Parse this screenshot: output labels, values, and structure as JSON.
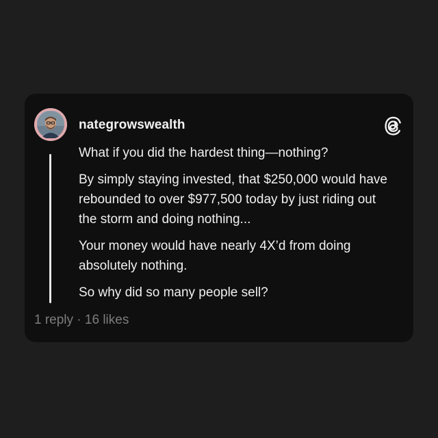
{
  "post": {
    "username": "nategrowswealth",
    "avatar_icon": "user-avatar-photo",
    "logo_icon": "threads-logo-icon",
    "paragraphs": [
      "What if you did the hardest thing—nothing?",
      "By simply staying invested, that $250,000 would have rebounded to over $977,500 today by just riding out the storm and doing nothing...",
      "Your money would have nearly 4X’d from doing absolutely nothing.",
      "So why did so many people sell?"
    ],
    "replies": "1 reply",
    "separator": " · ",
    "likes": "16 likes"
  },
  "colors": {
    "background": "#1e1e1e",
    "card": "#0f0f0f",
    "text": "#f0f0f0",
    "muted": "#7d7d7d",
    "avatar_ring": "#d89aa0"
  }
}
